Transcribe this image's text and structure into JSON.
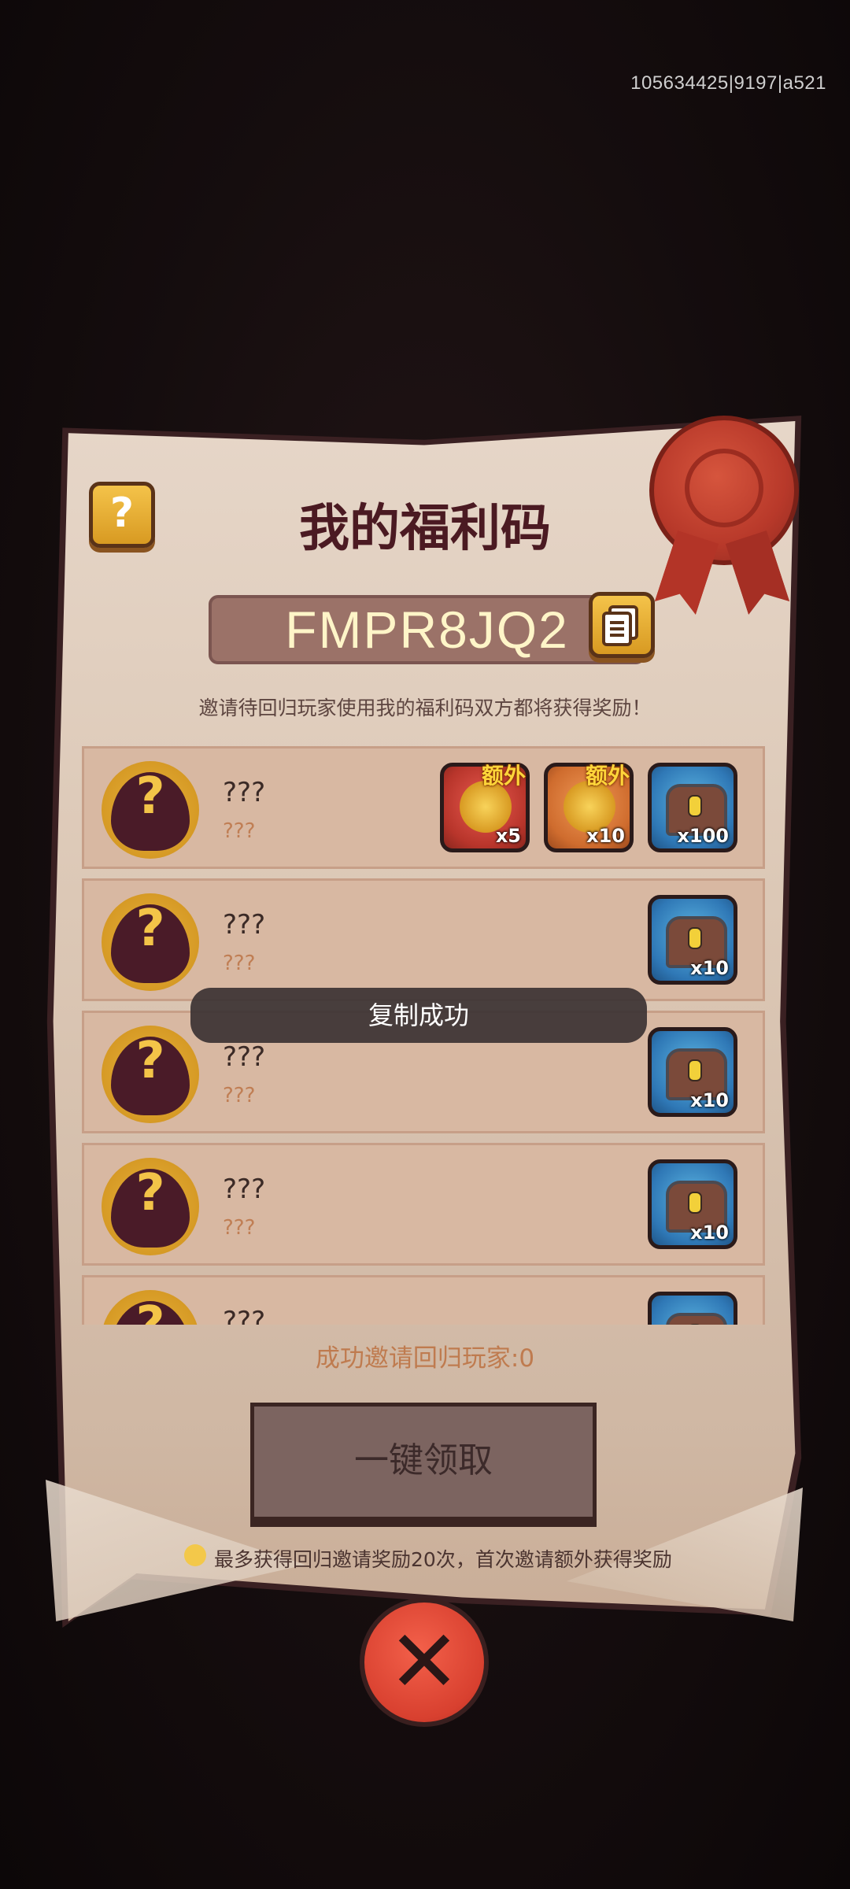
{
  "debug_id": "105634425|9197|a521",
  "panel": {
    "title": "我的福利码",
    "code": "FMPR8JQ2",
    "description": "邀请待回归玩家使用我的福利码双方都将获得奖励！",
    "help_label": "?"
  },
  "rows": [
    {
      "avatar_label": "?",
      "name": "???",
      "sub": "???",
      "rewards": [
        {
          "icon": "fishing-rod-icon",
          "color": "red",
          "qty": "x5",
          "badge": "额外"
        },
        {
          "icon": "lure-icon",
          "color": "orange",
          "qty": "x10",
          "badge": "额外"
        },
        {
          "icon": "treasure-chest-icon",
          "color": "blue",
          "qty": "x100",
          "badge": ""
        }
      ]
    },
    {
      "avatar_label": "?",
      "name": "???",
      "sub": "???",
      "rewards": [
        {
          "icon": "treasure-chest-icon",
          "color": "blue",
          "qty": "x10",
          "badge": ""
        }
      ]
    },
    {
      "avatar_label": "?",
      "name": "???",
      "sub": "???",
      "rewards": [
        {
          "icon": "treasure-chest-icon",
          "color": "blue",
          "qty": "x10",
          "badge": ""
        }
      ]
    },
    {
      "avatar_label": "?",
      "name": "???",
      "sub": "???",
      "rewards": [
        {
          "icon": "treasure-chest-icon",
          "color": "blue",
          "qty": "x10",
          "badge": ""
        }
      ]
    },
    {
      "avatar_label": "?",
      "name": "???",
      "sub": "???",
      "rewards": [
        {
          "icon": "treasure-chest-icon",
          "color": "blue",
          "qty": "",
          "badge": ""
        }
      ]
    }
  ],
  "toast": "复制成功",
  "invited_count_label": "成功邀请回归玩家:0",
  "claim_button": "一键领取",
  "note": "最多获得回归邀请奖励20次，首次邀请额外获得奖励",
  "close_label": "✕",
  "colors": {
    "title": "#4b1a22",
    "code_text": "#fff5c8",
    "sub_text": "#c07e54",
    "accent_gold": "#f3c448",
    "close_red": "#d8402f"
  }
}
